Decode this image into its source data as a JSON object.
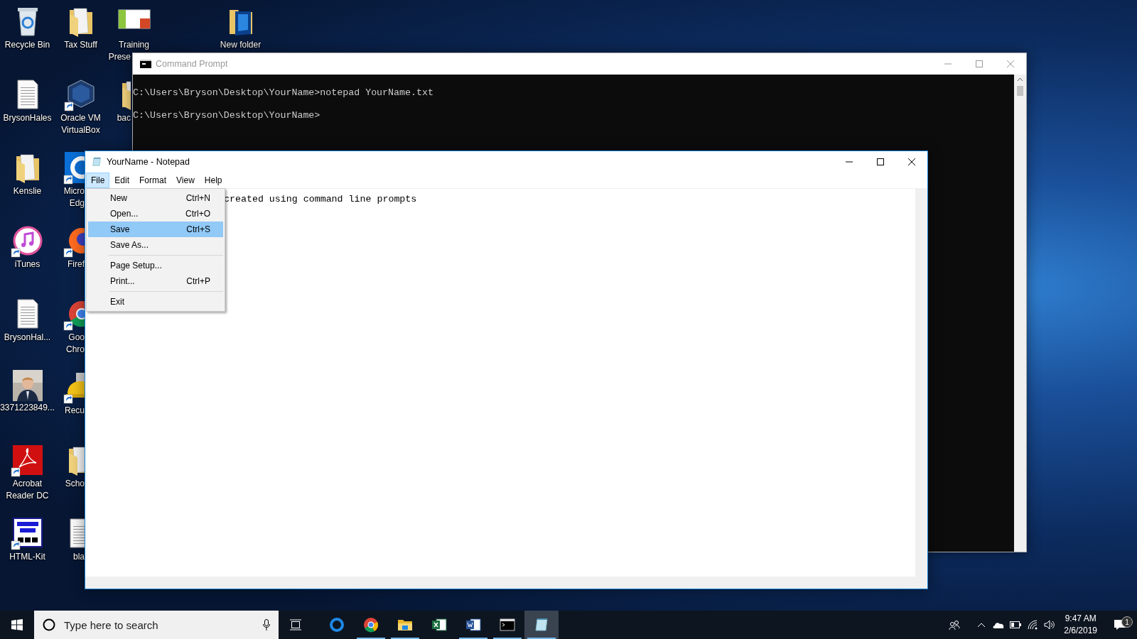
{
  "desktop_icons": [
    {
      "kind": "recycle",
      "lines": [
        "Recycle Bin"
      ],
      "shortcut": false
    },
    {
      "kind": "doc",
      "lines": [
        "BrysonHales"
      ],
      "shortcut": false
    },
    {
      "kind": "folder",
      "lines": [
        "Kenslie"
      ],
      "shortcut": false
    },
    {
      "kind": "itunes",
      "lines": [
        "iTunes"
      ],
      "shortcut": true
    },
    {
      "kind": "doc",
      "lines": [
        "BrysonHal..."
      ],
      "shortcut": false
    },
    {
      "lines": [
        "3371223849..."
      ],
      "shortcut": false
    },
    {
      "kind": "acrobat",
      "lines": [
        "Acrobat",
        "Reader DC"
      ],
      "shortcut": true
    },
    {
      "kind": "htmlkit",
      "lines": [
        "HTML-Kit"
      ],
      "shortcut": true
    },
    {
      "kind": "folder",
      "lines": [
        "Tax Stuff"
      ],
      "shortcut": false
    },
    {
      "kind": "vbox",
      "lines": [
        "Oracle VM",
        "VirtualBox"
      ],
      "shortcut": true
    },
    {
      "kind": "edge",
      "lines": [
        "Micro",
        "Edg"
      ],
      "shortcut": true
    },
    {
      "kind": "firefox",
      "lines": [
        "Firef"
      ],
      "shortcut": true
    },
    {
      "kind": "chrome",
      "lines": [
        "Goo",
        "Chro"
      ],
      "shortcut": true
    },
    {
      "kind": "recuva",
      "lines": [
        "Recu"
      ],
      "shortcut": true
    },
    {
      "kind": "folder",
      "lines": [
        "Scho"
      ],
      "shortcut": false
    },
    {
      "kind": "doc",
      "lines": [
        "bla"
      ],
      "shortcut": false
    },
    {
      "kind": "ppt",
      "lines": [
        "Training",
        "Prese"
      ],
      "shortcut": false
    },
    {
      "kind": "folder",
      "lines": [
        "bac"
      ],
      "shortcut": false
    },
    {
      "kind": "bluefolder",
      "lines": [
        "New folder"
      ],
      "shortcut": false
    }
  ],
  "cmd_window": {
    "title": "Command Prompt",
    "active": false,
    "lines": [
      "C:\\Users\\Bryson\\Desktop\\YourName>notepad YourName.txt",
      "C:\\Users\\Bryson\\Desktop\\YourName>"
    ]
  },
  "notepad": {
    "title": "YourName - Notepad",
    "active": true,
    "menus": [
      {
        "label": "File",
        "selected": true
      },
      {
        "label": "Edit",
        "selected": false
      },
      {
        "label": "Format",
        "selected": false
      },
      {
        "label": "View",
        "selected": false
      },
      {
        "label": "Help",
        "selected": false
      }
    ],
    "text": "created using command line prompts",
    "file_menu": [
      {
        "kind": "item",
        "label": "New",
        "shortcut": "Ctrl+N",
        "selected": false
      },
      {
        "kind": "item",
        "label": "Open...",
        "shortcut": "Ctrl+O",
        "selected": false
      },
      {
        "kind": "item",
        "label": "Save",
        "shortcut": "Ctrl+S",
        "selected": true
      },
      {
        "kind": "item",
        "label": "Save As...",
        "selected": false
      },
      {
        "kind": "separator"
      },
      {
        "kind": "item",
        "label": "Page Setup...",
        "selected": false
      },
      {
        "kind": "item",
        "label": "Print...",
        "shortcut": "Ctrl+P",
        "selected": false
      },
      {
        "kind": "separator"
      },
      {
        "kind": "item",
        "label": "Exit",
        "selected": false
      }
    ]
  },
  "taskbar": {
    "search": {
      "placeholder": "Type here to search"
    },
    "apps": [
      {
        "kind": "edge",
        "running": false,
        "selected": false
      },
      {
        "kind": "chrome",
        "running": true,
        "selected": false
      },
      {
        "kind": "explorer",
        "running": true,
        "selected": false
      },
      {
        "kind": "excel",
        "running": false,
        "selected": false
      },
      {
        "kind": "word",
        "running": true,
        "selected": false
      },
      {
        "kind": "cmd",
        "running": true,
        "selected": false
      },
      {
        "kind": "notepad",
        "running": true,
        "selected": true
      }
    ],
    "time": "9:47 AM",
    "date": "2/6/2019",
    "notifications": "1"
  }
}
